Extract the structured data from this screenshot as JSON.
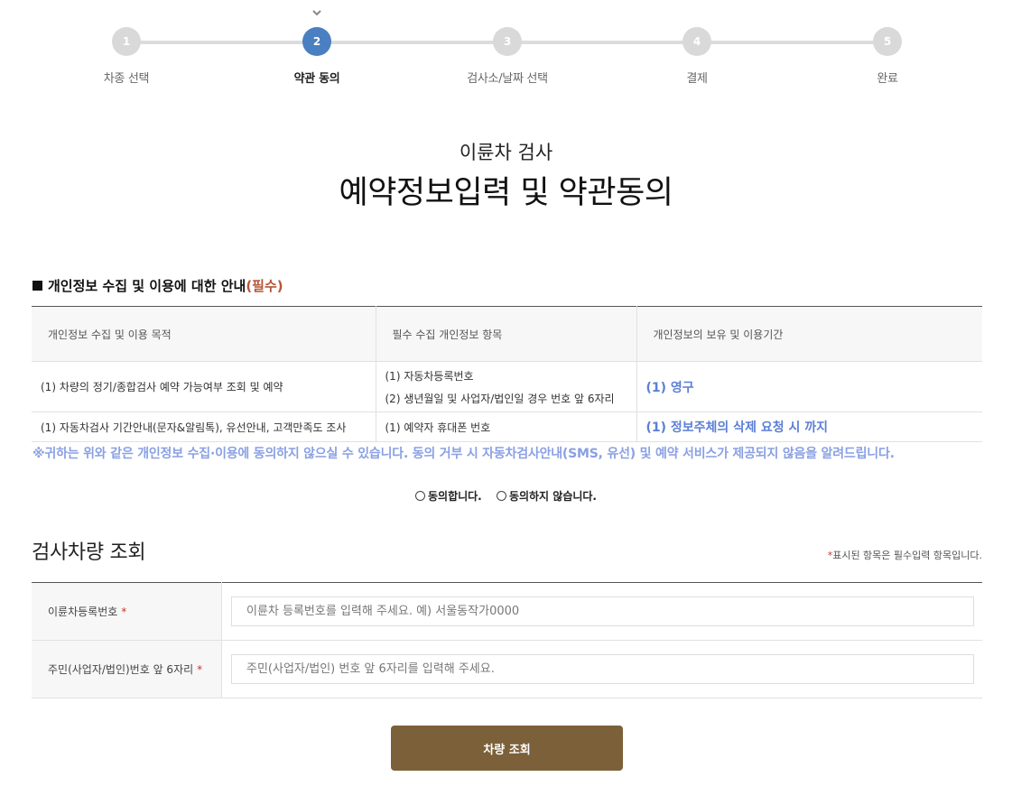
{
  "stepper": {
    "steps": [
      {
        "number": "1",
        "label": "차종 선택"
      },
      {
        "number": "2",
        "label": "약관 동의"
      },
      {
        "number": "3",
        "label": "검사소/날짜 선택"
      },
      {
        "number": "4",
        "label": "결제"
      },
      {
        "number": "5",
        "label": "완료"
      }
    ],
    "active_step": 2
  },
  "page": {
    "subtitle": "이륜차 검사",
    "title": "예약정보입력 및 약관동의"
  },
  "privacy": {
    "section_title": "개인정보 수집 및 이용에 대한 안내",
    "required_tag": "(필수)",
    "headers": [
      "개인정보 수집 및 이용 목적",
      "필수 수집 개인정보 항목",
      "개인정보의 보유 및 이용기간"
    ],
    "rows": [
      {
        "purpose": "(1) 차량의 정기/종합검사 예약 가능여부 조회 및 예약",
        "items_line1": "(1) 자동차등록번호",
        "items_line2": "(2) 생년월일 및 사업자/법인일 경우 번호 앞 6자리",
        "period": "(1) 영구"
      },
      {
        "purpose": "(1) 자동차검사 기간안내(문자&알림톡), 유선안내, 고객만족도 조사",
        "items_line1": "(1) 예약자 휴대폰 번호",
        "period": "(1) 정보주체의 삭제 요청 시 까지"
      }
    ],
    "notice": "※귀하는 위와 같은 개인정보 수집·이용에 동의하지 않으실 수 있습니다. 동의 거부 시 자동차검사안내(SMS, 유선) 및 예약 서비스가 제공되지 않음을 알려드립니다.",
    "agree_label": "동의합니다.",
    "disagree_label": "동의하지 않습니다."
  },
  "lookup": {
    "title": "검사차량 조회",
    "required_note_star": "*",
    "required_note": "표시된 항목은 필수입력 항목입니다.",
    "fields": [
      {
        "label": "이륜차등록번호",
        "star": "*",
        "placeholder": "이륜차 등록번호를 입력해 주세요. 예) 서울동작가0000",
        "value": ""
      },
      {
        "label": "주민(사업자/법인)번호 앞 6자리",
        "star": "*",
        "placeholder": "주민(사업자/법인) 번호 앞 6자리를 입력해 주세요.",
        "value": ""
      }
    ],
    "submit_label": "차량 조회"
  },
  "colors": {
    "active_step": "#4a7fc1",
    "inactive_step": "#d9d9d9",
    "required_tag": "#b5563a",
    "notice_text": "#8aa0e3",
    "period_text": "#5b7fd6",
    "submit_button": "#7b6039"
  }
}
